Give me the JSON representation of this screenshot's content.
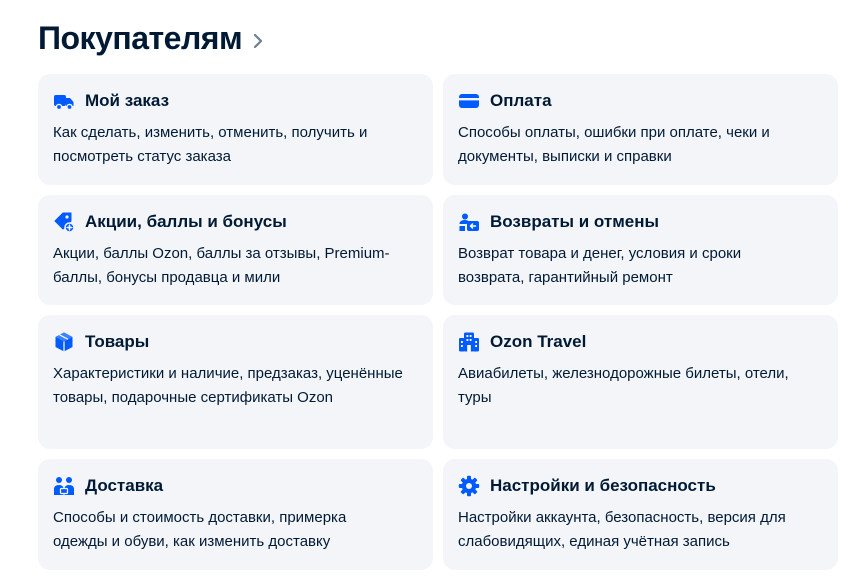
{
  "section": {
    "title": "Покупателям"
  },
  "cards": [
    {
      "title": "Мой заказ",
      "description": "Как сделать, изменить, отменить, получить и посмотреть статус заказа",
      "icon": "delivery-truck-icon"
    },
    {
      "title": "Оплата",
      "description": "Способы оплаты, ошибки при оплате, чеки и документы, выписки и справки",
      "icon": "credit-card-icon"
    },
    {
      "title": "Акции, баллы и бонусы",
      "description": "Акции, баллы Ozon, баллы за отзывы, Premium-баллы, бонусы продавца и мили",
      "icon": "price-tag-plus-icon"
    },
    {
      "title": "Возвраты и отмены",
      "description": "Возврат товара и денег, условия и сроки возврата, гарантийный ремонт",
      "icon": "return-box-icon"
    },
    {
      "title": "Товары",
      "description": "Характеристики и наличие, предзаказ, уценённые товары, подарочные сертификаты Ozon",
      "icon": "product-box-icon"
    },
    {
      "title": "Ozon Travel",
      "description": "Авиабилеты, железнодорожные билеты, отели, туры",
      "icon": "hotel-building-icon"
    },
    {
      "title": "Доставка",
      "description": "Способы и стоимость доставки, примерка одежды и обуви, как изменить доставку",
      "icon": "couriers-icon"
    },
    {
      "title": "Настройки и безопасность",
      "description": "Настройки аккаунта, безопасность, версия для слабовидящих, единая учётная запись",
      "icon": "settings-gear-icon"
    }
  ],
  "colors": {
    "accent": "#005bff",
    "card_background": "#f3f5f9",
    "text": "#001a34",
    "chevron": "#707f8d"
  }
}
